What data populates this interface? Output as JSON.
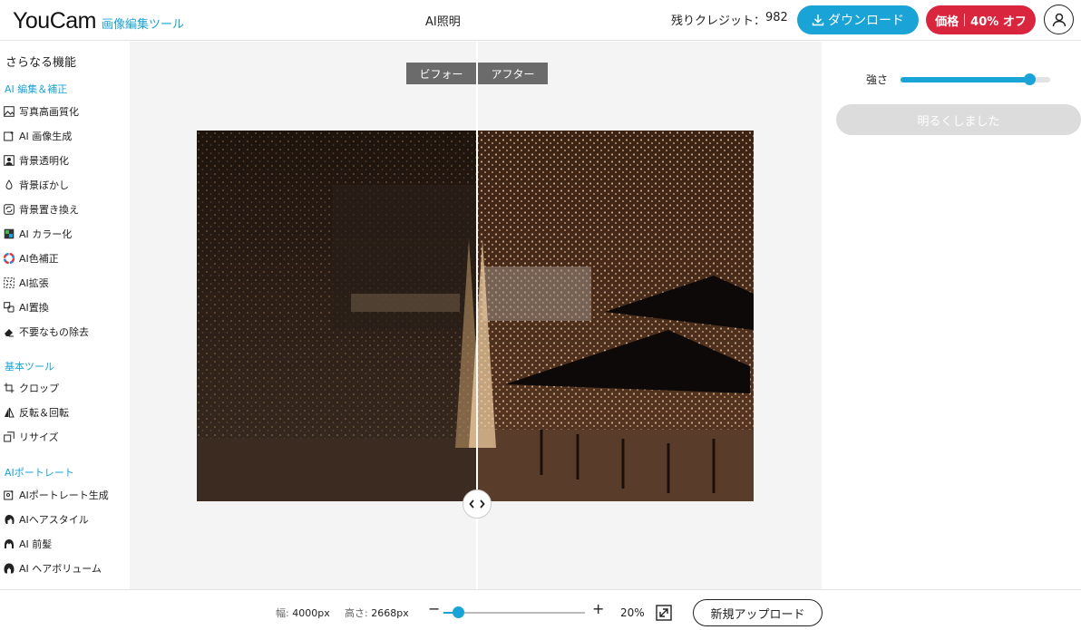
{
  "header": {
    "logo_main": "YouCam",
    "logo_sub": "画像編集ツール",
    "page_title": "AI照明",
    "credits_label": "残りクレジット：",
    "credits_value": "982",
    "download_label": "ダウンロード",
    "price_label": "価格",
    "discount_label": "40% オフ"
  },
  "sidebar": {
    "title": "さらなる機能",
    "sections": [
      {
        "label": "AI 編集＆補正",
        "items": [
          {
            "label": "写真高画質化",
            "icon": "image-enhance-icon"
          },
          {
            "label": "AI 画像生成",
            "icon": "image-generate-icon"
          },
          {
            "label": "背景透明化",
            "icon": "background-remove-icon"
          },
          {
            "label": "背景ぼかし",
            "icon": "blur-drop-icon"
          },
          {
            "label": "背景置き換え",
            "icon": "background-replace-icon"
          },
          {
            "label": "AI カラー化",
            "icon": "colorize-icon"
          },
          {
            "label": "AI色補正",
            "icon": "color-wheel-icon"
          },
          {
            "label": "AI拡張",
            "icon": "expand-icon"
          },
          {
            "label": "AI置換",
            "icon": "replace-icon"
          },
          {
            "label": "不要なもの除去",
            "icon": "eraser-icon"
          }
        ]
      },
      {
        "label": "基本ツール",
        "items": [
          {
            "label": "クロップ",
            "icon": "crop-icon"
          },
          {
            "label": "反転＆回転",
            "icon": "flip-icon"
          },
          {
            "label": "リサイズ",
            "icon": "resize-icon"
          }
        ]
      },
      {
        "label": "AIポートレート",
        "items": [
          {
            "label": "AIポートレート生成",
            "icon": "portrait-generate-icon"
          },
          {
            "label": "AIヘアスタイル",
            "icon": "hairstyle-icon"
          },
          {
            "label": "AI 前髪",
            "icon": "bangs-icon"
          },
          {
            "label": "AI ヘアボリューム",
            "icon": "hair-volume-icon"
          }
        ]
      }
    ]
  },
  "canvas": {
    "before_label": "ビフォー",
    "after_label": "アフター"
  },
  "panel": {
    "strength_label": "強さ",
    "strength_value": 0.86,
    "apply_label": "明るくしました"
  },
  "bottombar": {
    "width_label": "幅:",
    "width_value": "4000px",
    "height_label": "高さ:",
    "height_value": "2668px",
    "zoom_minus": "−",
    "zoom_plus": "+",
    "zoom_value": 0.1,
    "zoom_label": "20%",
    "upload_label": "新規アップロード"
  },
  "colors": {
    "accent": "#1aa3d6",
    "price": "#d9253d",
    "canvas_bg": "#f4f4f4"
  }
}
